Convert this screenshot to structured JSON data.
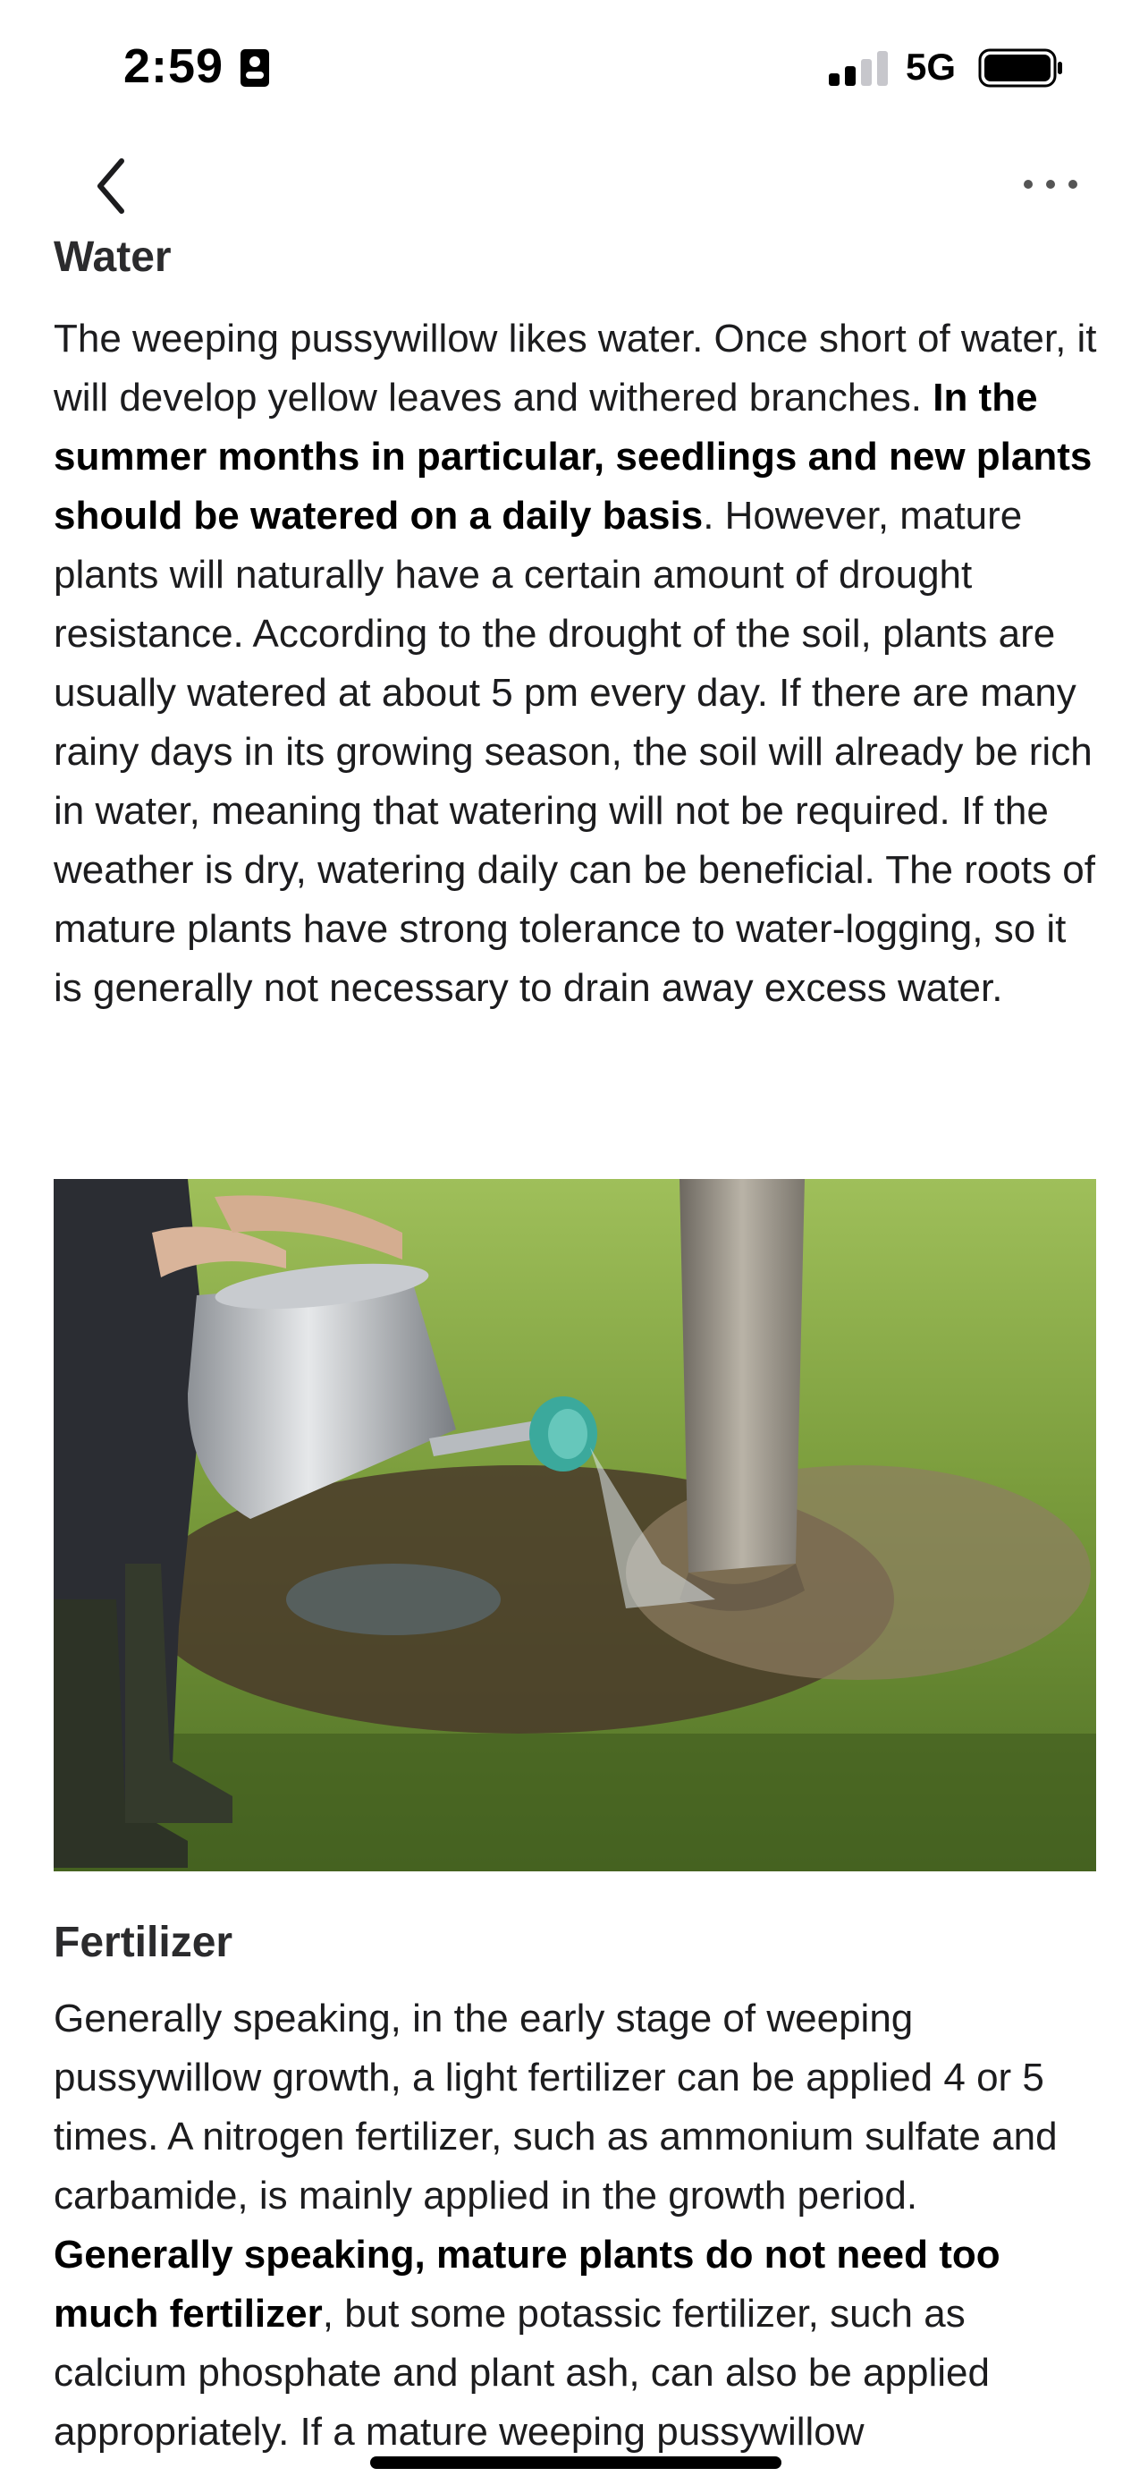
{
  "status_bar": {
    "time": "2:59",
    "network": "5G",
    "icons": [
      "id-card-icon",
      "signal-icon",
      "battery-icon"
    ]
  },
  "nav": {
    "back_icon": "chevron-left-icon",
    "more_icon": "ellipsis-icon"
  },
  "sections": {
    "water": {
      "title": "Water",
      "p1": "The weeping pussywillow likes water. Once short of water, it will develop yellow leaves and withered branches. ",
      "b1": "In the summer months in particular, seedlings and new plants should be watered on a daily basis",
      "p2": ". However, mature plants will naturally have a certain amount of drought resistance. According to the drought of the soil, plants are usually watered at about 5 pm every day. If there are many rainy days in its growing season, the soil will already be rich in water, meaning that watering will not be required. If the weather is dry, watering daily can be beneficial. The roots of mature plants have strong tolerance to water-logging, so it is generally not necessary to drain away excess water."
    },
    "fertilizer": {
      "title": "Fertilizer",
      "p1": "Generally speaking, in the early stage of weeping pussywillow growth, a light fertilizer can be applied 4 or 5 times. A nitrogen fertilizer, such as ammonium sulfate and carbamide, is mainly applied in the growth period. ",
      "b1": "Generally speaking, mature plants do not need too much fertilizer",
      "p2": ", but some potassic fertilizer, such as calcium phosphate and plant ash, can also be applied appropriately. If a mature weeping pussywillow"
    }
  },
  "colors": {
    "text": "#1c1c1e",
    "heading": "#2b2b2d",
    "background": "#ffffff"
  }
}
